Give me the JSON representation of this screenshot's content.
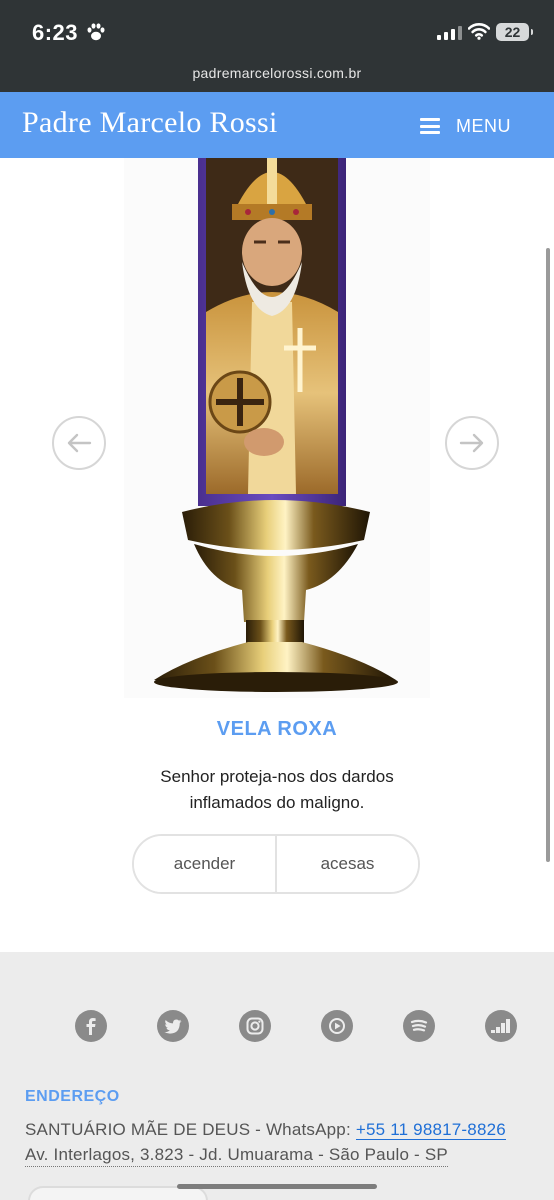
{
  "status_bar": {
    "time": "6:23",
    "battery": "22",
    "icons": [
      "paw-icon",
      "signal-icon",
      "wifi-icon",
      "battery-icon"
    ]
  },
  "browser": {
    "url": "padremarcelorossi.com.br"
  },
  "header": {
    "title": "Padre Marcelo Rossi",
    "menu_label": "MENU",
    "brand_color": "#5c9df1"
  },
  "carousel": {
    "candle_name": "VELA ROXA",
    "description": "Senhor proteja-nos dos dardos inflamados do maligno.",
    "candle_color": "#5a3aa6",
    "prev_icon": "arrow-left-icon",
    "next_icon": "arrow-right-icon"
  },
  "actions": {
    "light_label": "acender",
    "lit_label": "acesas"
  },
  "footer": {
    "social_icons": [
      "facebook-icon",
      "twitter-icon",
      "instagram-icon",
      "youtube-icon",
      "spotify-icon",
      "deezer-icon"
    ],
    "address_title": "ENDEREÇO",
    "address_line1_prefix": "SANTUÁRIO MÃE DE DEUS - WhatsApp: ",
    "phone": "+55 11 98817-8826",
    "address_line2": "Av. Interlagos, 3.823 - Jd. Umuarama - São Paulo - SP"
  }
}
